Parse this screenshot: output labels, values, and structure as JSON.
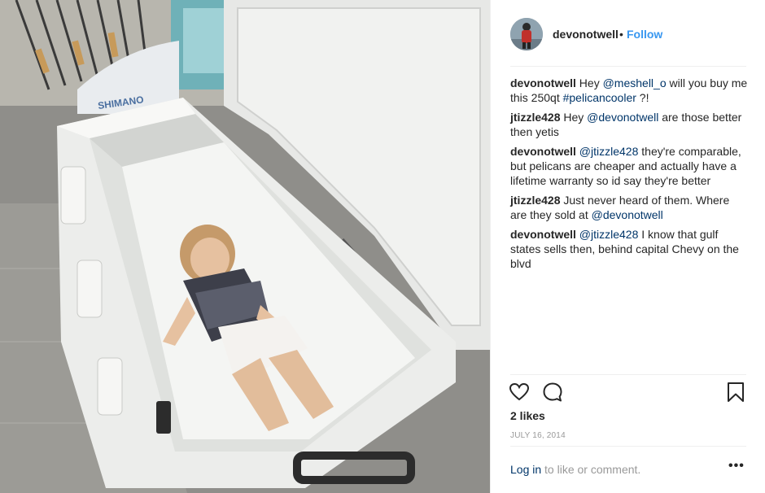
{
  "post": {
    "username": "devonotwell",
    "separator": "•",
    "follow_label": "Follow"
  },
  "comments": [
    {
      "user": "devonotwell",
      "parts": [
        {
          "t": "Hey "
        },
        {
          "t": "@meshell_o",
          "link": true
        },
        {
          "t": " will you buy me this 250qt "
        },
        {
          "t": "#pelicancooler",
          "link": true
        },
        {
          "t": " ?!"
        }
      ]
    },
    {
      "user": "jtizzle428",
      "parts": [
        {
          "t": "Hey "
        },
        {
          "t": "@devonotwell",
          "link": true
        },
        {
          "t": " are those better then yetis"
        }
      ]
    },
    {
      "user": "devonotwell",
      "parts": [
        {
          "t": "@jtizzle428",
          "link": true
        },
        {
          "t": " they're comparable, but pelicans are cheaper and actually have a lifetime warranty so id say they're better"
        }
      ]
    },
    {
      "user": "jtizzle428",
      "parts": [
        {
          "t": "Just never heard of them. Where are they sold at "
        },
        {
          "t": "@devonotwell",
          "link": true
        }
      ]
    },
    {
      "user": "devonotwell",
      "parts": [
        {
          "t": "@jtizzle428",
          "link": true
        },
        {
          "t": " I know that gulf states sells then, behind capital Chevy on the blvd"
        }
      ]
    }
  ],
  "actions": {
    "like_icon": "heart-icon",
    "comment_icon": "speech-bubble-icon",
    "save_icon": "bookmark-icon"
  },
  "likes_text": "2 likes",
  "date_text": "JULY 16, 2014",
  "login": {
    "link_text": "Log in",
    "rest_text": " to like or comment.",
    "more_label": "•••"
  },
  "photo": {
    "brand_text": "SHIMANO"
  }
}
